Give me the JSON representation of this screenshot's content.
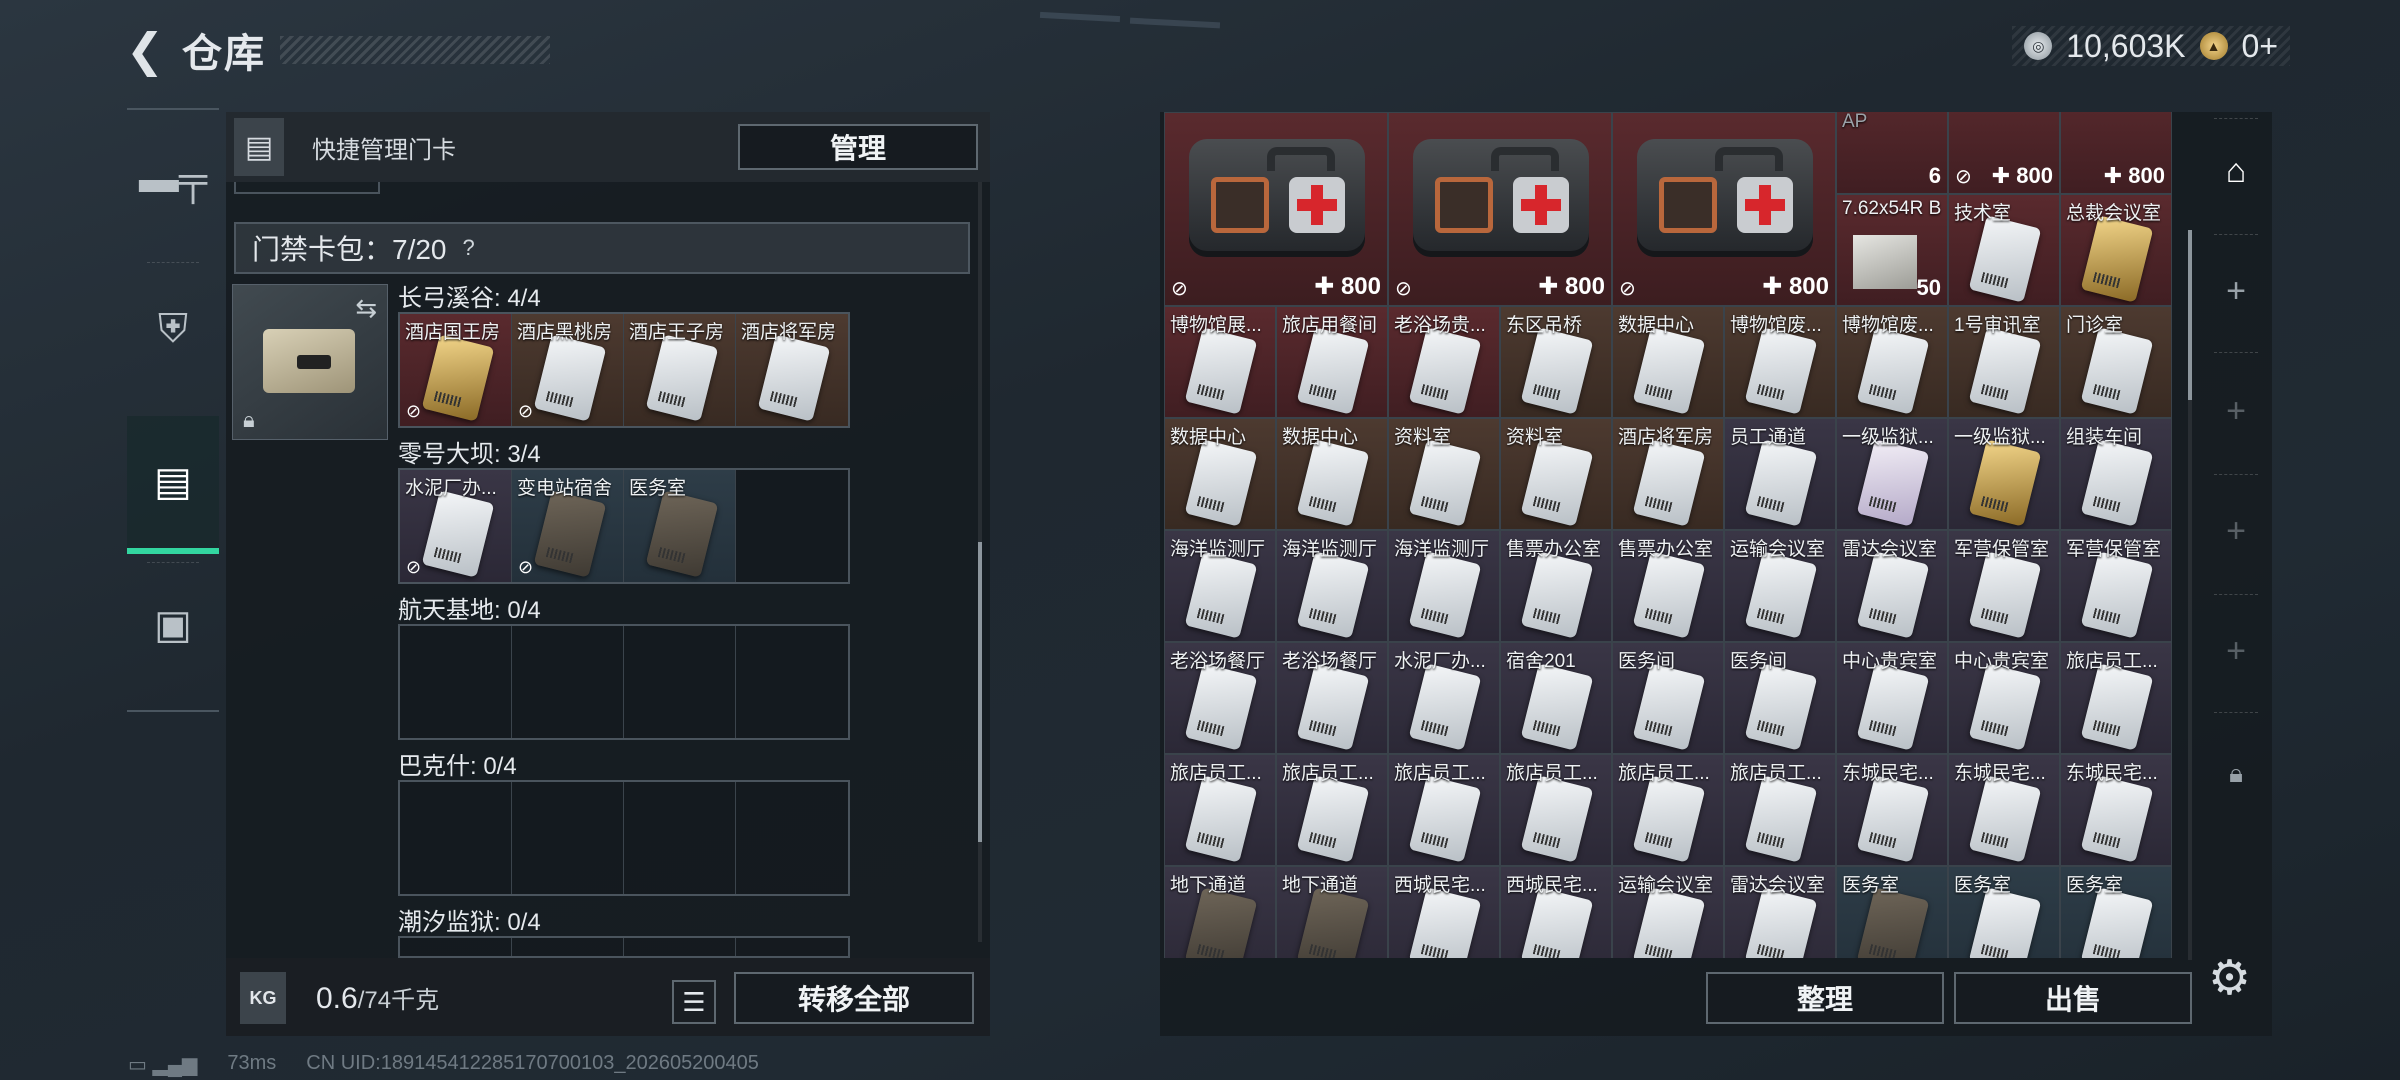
{
  "header": {
    "title": "仓库"
  },
  "currency": {
    "silver": "10,603K",
    "gold": "0+"
  },
  "left_panel": {
    "quick_label": "快捷管理门卡",
    "manage_label": "管理",
    "pack_title": "门禁卡包：7/20",
    "pack_help": "?",
    "groups": [
      {
        "title": "长弓溪谷: 4/4",
        "slots": [
          {
            "name": "酒店国王房",
            "bg": "red",
            "card": "gold",
            "badge": true
          },
          {
            "name": "酒店黑桃房",
            "bg": "brown",
            "card": "white",
            "badge": true
          },
          {
            "name": "酒店王子房",
            "bg": "brown",
            "card": "white",
            "badge": false
          },
          {
            "name": "酒店将军房",
            "bg": "brown",
            "card": "white",
            "badge": false
          }
        ]
      },
      {
        "title": "零号大坝: 3/4",
        "slots": [
          {
            "name": "水泥厂办...",
            "bg": "purple",
            "card": "white",
            "badge": true
          },
          {
            "name": "变电站宿舍",
            "bg": "blue",
            "card": "dark",
            "badge": true
          },
          {
            "name": "医务室",
            "bg": "blue",
            "card": "dark",
            "badge": false
          },
          {
            "name": "",
            "bg": "empty",
            "card": "",
            "badge": false
          }
        ]
      },
      {
        "title": "航天基地: 0/4",
        "slots": []
      },
      {
        "title": "巴克什: 0/4",
        "slots": []
      },
      {
        "title": "潮汐监狱: 0/4",
        "slots": []
      }
    ],
    "weight_value": "0.6",
    "weight_max": "/74千克",
    "kg_label": "KG",
    "transfer_all_label": "转移全部"
  },
  "right_panel": {
    "medkit_count": "800",
    "top_small": [
      {
        "name": "AP",
        "count": "6"
      },
      {
        "name": "",
        "count": "800"
      },
      {
        "name": "7.62x54R B",
        "count": "50"
      },
      {
        "name": "技术室",
        "count": ""
      },
      {
        "name": "总裁会议室",
        "count": ""
      }
    ],
    "rows": [
      [
        {
          "n": "博物馆展...",
          "bg": "red",
          "c": "white"
        },
        {
          "n": "旅店用餐间",
          "bg": "red",
          "c": "white"
        },
        {
          "n": "老浴场贵...",
          "bg": "red",
          "c": "white"
        },
        {
          "n": "东区吊桥",
          "bg": "brown",
          "c": "white"
        },
        {
          "n": "数据中心",
          "bg": "brown",
          "c": "white"
        },
        {
          "n": "博物馆废...",
          "bg": "brown",
          "c": "white"
        },
        {
          "n": "博物馆废...",
          "bg": "brown",
          "c": "white"
        },
        {
          "n": "1号审讯室",
          "bg": "brown",
          "c": "white"
        },
        {
          "n": "门诊室",
          "bg": "brown",
          "c": "white"
        }
      ],
      [
        {
          "n": "数据中心",
          "bg": "brown",
          "c": "white"
        },
        {
          "n": "数据中心",
          "bg": "brown",
          "c": "white"
        },
        {
          "n": "资料室",
          "bg": "brown",
          "c": "white"
        },
        {
          "n": "资料室",
          "bg": "brown",
          "c": "white"
        },
        {
          "n": "酒店将军房",
          "bg": "brown",
          "c": "white"
        },
        {
          "n": "员工通道",
          "bg": "purple",
          "c": "white"
        },
        {
          "n": "一级监狱...",
          "bg": "purple",
          "c": "purplec"
        },
        {
          "n": "一级监狱...",
          "bg": "purple",
          "c": "gold"
        },
        {
          "n": "组装车间",
          "bg": "purple",
          "c": "white"
        }
      ],
      [
        {
          "n": "海洋监测厅",
          "bg": "purple",
          "c": "white"
        },
        {
          "n": "海洋监测厅",
          "bg": "purple",
          "c": "white"
        },
        {
          "n": "海洋监测厅",
          "bg": "purple",
          "c": "white"
        },
        {
          "n": "售票办公室",
          "bg": "purple",
          "c": "white"
        },
        {
          "n": "售票办公室",
          "bg": "purple",
          "c": "white"
        },
        {
          "n": "运输会议室",
          "bg": "purple",
          "c": "white"
        },
        {
          "n": "雷达会议室",
          "bg": "purple",
          "c": "white"
        },
        {
          "n": "军营保管室",
          "bg": "purple",
          "c": "white"
        },
        {
          "n": "军营保管室",
          "bg": "purple",
          "c": "white"
        }
      ],
      [
        {
          "n": "老浴场餐厅",
          "bg": "purple",
          "c": "white"
        },
        {
          "n": "老浴场餐厅",
          "bg": "purple",
          "c": "white"
        },
        {
          "n": "水泥厂办...",
          "bg": "purple",
          "c": "white"
        },
        {
          "n": "宿舍201",
          "bg": "purple",
          "c": "white"
        },
        {
          "n": "医务间",
          "bg": "purple",
          "c": "white"
        },
        {
          "n": "医务间",
          "bg": "purple",
          "c": "white"
        },
        {
          "n": "中心贵宾室",
          "bg": "purple",
          "c": "white"
        },
        {
          "n": "中心贵宾室",
          "bg": "purple",
          "c": "white"
        },
        {
          "n": "旅店员工...",
          "bg": "purple",
          "c": "white"
        }
      ],
      [
        {
          "n": "旅店员工...",
          "bg": "purple",
          "c": "white"
        },
        {
          "n": "旅店员工...",
          "bg": "purple",
          "c": "white"
        },
        {
          "n": "旅店员工...",
          "bg": "purple",
          "c": "white"
        },
        {
          "n": "旅店员工...",
          "bg": "purple",
          "c": "white"
        },
        {
          "n": "旅店员工...",
          "bg": "purple",
          "c": "white"
        },
        {
          "n": "旅店员工...",
          "bg": "purple",
          "c": "white"
        },
        {
          "n": "东城民宅...",
          "bg": "purple",
          "c": "white"
        },
        {
          "n": "东城民宅...",
          "bg": "purple",
          "c": "white"
        },
        {
          "n": "东城民宅...",
          "bg": "purple",
          "c": "white"
        }
      ],
      [
        {
          "n": "地下通道",
          "bg": "purple",
          "c": "dark"
        },
        {
          "n": "地下通道",
          "bg": "purple",
          "c": "dark"
        },
        {
          "n": "西城民宅...",
          "bg": "purple",
          "c": "white"
        },
        {
          "n": "西城民宅...",
          "bg": "purple",
          "c": "white"
        },
        {
          "n": "运输会议室",
          "bg": "purple",
          "c": "white"
        },
        {
          "n": "雷达会议室",
          "bg": "purple",
          "c": "white"
        },
        {
          "n": "医务室",
          "bg": "blue",
          "c": "dark"
        },
        {
          "n": "医务室",
          "bg": "blue",
          "c": "white"
        },
        {
          "n": "医务室",
          "bg": "blue",
          "c": "white"
        }
      ]
    ],
    "sort_label": "整理",
    "sell_label": "出售"
  },
  "status": {
    "ping": "73ms",
    "uid": "CN UID:18914541228517070010​3_202605200405"
  },
  "colors": {
    "accent": "#33d6a0",
    "medkit_red": "#d7262c"
  }
}
